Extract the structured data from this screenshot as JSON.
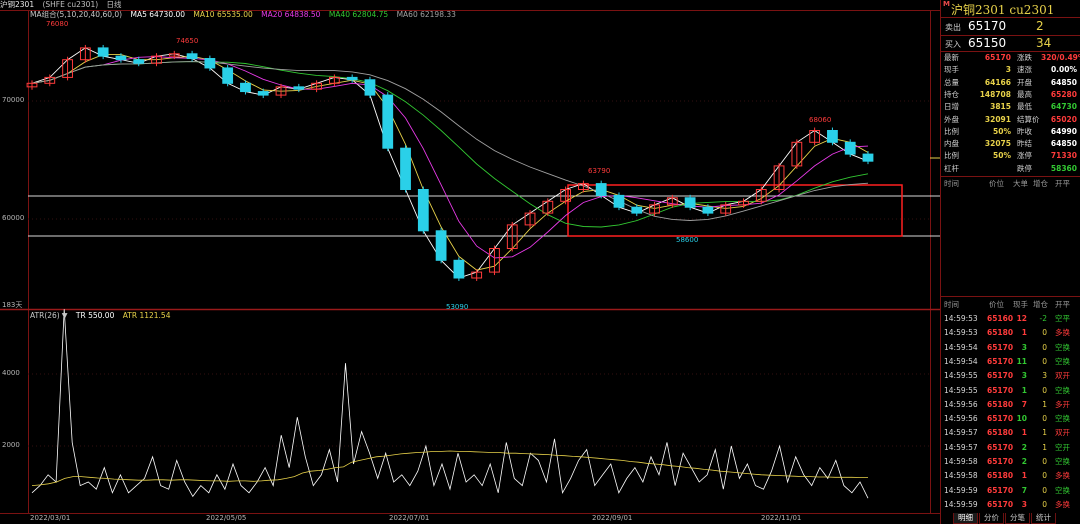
{
  "header": {
    "title": "沪铜2301",
    "code": "(SHFE cu2301)",
    "period": "日线"
  },
  "ma": {
    "label": "MA组合(5,10,20,40,60,0)",
    "ma5": "MA5 64730.00",
    "ma10": "MA10 65535.00",
    "ma20": "MA20 64838.50",
    "ma40": "MA40 62804.75",
    "ma60": "MA60 62198.33"
  },
  "colors": {
    "up": "#ff3b3b",
    "down": "#2ad0e8",
    "ma5": "#ffffff",
    "ma10": "#e8d24a",
    "ma20": "#e83ae8",
    "ma40": "#32c832",
    "ma60": "#a0a0a0",
    "accent": "#e8d24a"
  },
  "price_axis": {
    "ticks": [
      "70000",
      "60000"
    ],
    "days": "183天"
  },
  "price_labels": {
    "p76080": "76080",
    "p74650": "74650",
    "p53090": "53090",
    "p63790": "63790",
    "p58600": "58600",
    "p68060": "68060"
  },
  "atr": {
    "label": "ATR(26)",
    "arrow": "▼",
    "tr": "TR 550.00",
    "atr": "ATR 1121.54",
    "ticks": [
      "4000",
      "2000"
    ]
  },
  "xaxis": [
    "2022/03/01",
    "2022/05/05",
    "2022/07/01",
    "2022/09/01",
    "2022/11/01"
  ],
  "panel": {
    "marker": "M",
    "name": "沪铜2301  cu2301",
    "sell_label": "卖出",
    "sell_price": "65170",
    "sell_qty": "2",
    "buy_label": "买入",
    "buy_price": "65150",
    "buy_qty": "34",
    "quotes": [
      {
        "k1": "最新",
        "v1": "65170",
        "c1": "#ff3b3b",
        "k2": "涨跌",
        "v2": "320/0.49%",
        "c2": "#ff3b3b"
      },
      {
        "k1": "现手",
        "v1": "3",
        "c1": "#e8d24a",
        "k2": "速涨",
        "v2": "0.00%",
        "c2": "#ffffff"
      },
      {
        "k1": "总量",
        "v1": "64166",
        "c1": "#e8d24a",
        "k2": "开盘",
        "v2": "64850",
        "c2": "#ffffff"
      },
      {
        "k1": "持仓",
        "v1": "148708",
        "c1": "#e8d24a",
        "k2": "最高",
        "v2": "65280",
        "c2": "#ff3b3b"
      },
      {
        "k1": "日增",
        "v1": "3815",
        "c1": "#e8d24a",
        "k2": "最低",
        "v2": "64730",
        "c2": "#32c832"
      },
      {
        "k1": "外盘",
        "v1": "32091",
        "c1": "#e8d24a",
        "k2": "结算价",
        "v2": "65020",
        "c2": "#ff3b3b"
      },
      {
        "k1": "比例",
        "v1": "50%",
        "c1": "#e8d24a",
        "k2": "昨收",
        "v2": "64990",
        "c2": "#ffffff"
      },
      {
        "k1": "内盘",
        "v1": "32075",
        "c1": "#e8d24a",
        "k2": "昨结",
        "v2": "64850",
        "c2": "#ffffff"
      },
      {
        "k1": "比例",
        "v1": "50%",
        "c1": "#e8d24a",
        "k2": "涨停",
        "v2": "71330",
        "c2": "#ff3b3b"
      },
      {
        "k1": "杠杆",
        "v1": "",
        "c1": "#e8d24a",
        "k2": "跌停",
        "v2": "58360",
        "c2": "#32c832"
      }
    ],
    "hdr1": {
      "time": "时间",
      "price": "价位",
      "big": "大单",
      "add": "增仓",
      "oc": "开平"
    },
    "hdr2": {
      "time": "时间",
      "price": "价位",
      "qty": "现手",
      "add": "增仓",
      "oc": "开平"
    },
    "ticks": [
      {
        "time": "14:59:53",
        "price": "65160",
        "qty": "12",
        "add": "-2",
        "oc": "空平",
        "pc": "#ff3b3b",
        "qc": "#ff3b3b",
        "ac": "#32c832",
        "oc_c": "#32c832"
      },
      {
        "time": "14:59:53",
        "price": "65180",
        "qty": "1",
        "add": "0",
        "oc": "多换",
        "pc": "#ff3b3b",
        "qc": "#ff3b3b",
        "ac": "#e8d24a",
        "oc_c": "#ff3b3b"
      },
      {
        "time": "14:59:54",
        "price": "65170",
        "qty": "3",
        "add": "0",
        "oc": "空换",
        "pc": "#ff3b3b",
        "qc": "#32c832",
        "ac": "#e8d24a",
        "oc_c": "#32c832"
      },
      {
        "time": "14:59:54",
        "price": "65170",
        "qty": "11",
        "add": "0",
        "oc": "空换",
        "pc": "#ff3b3b",
        "qc": "#32c832",
        "ac": "#e8d24a",
        "oc_c": "#32c832"
      },
      {
        "time": "14:59:55",
        "price": "65170",
        "qty": "3",
        "add": "3",
        "oc": "双开",
        "pc": "#ff3b3b",
        "qc": "#32c832",
        "ac": "#e8d24a",
        "oc_c": "#ff3b3b"
      },
      {
        "time": "14:59:55",
        "price": "65170",
        "qty": "1",
        "add": "0",
        "oc": "空换",
        "pc": "#ff3b3b",
        "qc": "#32c832",
        "ac": "#e8d24a",
        "oc_c": "#32c832"
      },
      {
        "time": "14:59:56",
        "price": "65180",
        "qty": "7",
        "add": "1",
        "oc": "多开",
        "pc": "#ff3b3b",
        "qc": "#ff3b3b",
        "ac": "#e8d24a",
        "oc_c": "#ff3b3b"
      },
      {
        "time": "14:59:56",
        "price": "65170",
        "qty": "10",
        "add": "0",
        "oc": "空换",
        "pc": "#ff3b3b",
        "qc": "#32c832",
        "ac": "#e8d24a",
        "oc_c": "#32c832"
      },
      {
        "time": "14:59:57",
        "price": "65180",
        "qty": "1",
        "add": "1",
        "oc": "双开",
        "pc": "#ff3b3b",
        "qc": "#ff3b3b",
        "ac": "#e8d24a",
        "oc_c": "#ff3b3b"
      },
      {
        "time": "14:59:57",
        "price": "65170",
        "qty": "2",
        "add": "1",
        "oc": "空开",
        "pc": "#ff3b3b",
        "qc": "#32c832",
        "ac": "#e8d24a",
        "oc_c": "#32c832"
      },
      {
        "time": "14:59:58",
        "price": "65170",
        "qty": "2",
        "add": "0",
        "oc": "空换",
        "pc": "#ff3b3b",
        "qc": "#32c832",
        "ac": "#e8d24a",
        "oc_c": "#32c832"
      },
      {
        "time": "14:59:58",
        "price": "65180",
        "qty": "1",
        "add": "0",
        "oc": "多换",
        "pc": "#ff3b3b",
        "qc": "#ff3b3b",
        "ac": "#e8d24a",
        "oc_c": "#ff3b3b"
      },
      {
        "time": "14:59:59",
        "price": "65170",
        "qty": "7",
        "add": "0",
        "oc": "空换",
        "pc": "#ff3b3b",
        "qc": "#32c832",
        "ac": "#e8d24a",
        "oc_c": "#32c832"
      },
      {
        "time": "14:59:59",
        "price": "65170",
        "qty": "3",
        "add": "0",
        "oc": "多换",
        "pc": "#ff3b3b",
        "qc": "#ff3b3b",
        "ac": "#e8d24a",
        "oc_c": "#ff3b3b"
      }
    ],
    "tabs": [
      "明细",
      "分价",
      "分笔",
      "统计"
    ]
  },
  "chart_data": [
    {
      "type": "candlestick",
      "title": "沪铜2301 (SHFE cu2301) 日线",
      "series_names": [
        "MA5",
        "MA10",
        "MA20",
        "MA40",
        "MA60"
      ],
      "y_ticks": [
        70000,
        60000
      ],
      "annotations": [
        {
          "label": "76080",
          "type": "high"
        },
        {
          "label": "74650",
          "type": "high"
        },
        {
          "label": "53090",
          "type": "low"
        },
        {
          "label": "63790",
          "type": "high"
        },
        {
          "label": "58600",
          "type": "low"
        },
        {
          "label": "68060",
          "type": "high"
        }
      ],
      "close_approx": [
        71500,
        72000,
        73500,
        74500,
        73800,
        73500,
        73200,
        73800,
        74000,
        73600,
        72800,
        71500,
        70800,
        70500,
        71200,
        71000,
        71500,
        72000,
        71800,
        70500,
        66000,
        62500,
        59000,
        56500,
        55000,
        55500,
        57500,
        59500,
        60500,
        61500,
        62500,
        63000,
        62000,
        61000,
        60500,
        61200,
        61800,
        61000,
        60500,
        61200,
        61500,
        62500,
        64500,
        66500,
        67500,
        66500,
        65500,
        64900
      ]
    },
    {
      "type": "line",
      "title": "ATR(26)",
      "series_names": [
        "TR",
        "ATR"
      ],
      "y_ticks": [
        4000,
        2000
      ],
      "tr": [
        700,
        900,
        1200,
        1000,
        5800,
        2100,
        900,
        1000,
        800,
        1400,
        700,
        1200,
        700,
        900,
        1100,
        1700,
        900,
        800,
        1600,
        1000,
        600,
        900,
        700,
        1200,
        800,
        1500,
        900,
        700,
        1000,
        1400,
        900,
        2300,
        1400,
        2800,
        1700,
        900,
        1200,
        1900,
        1000,
        4300,
        1500,
        2400,
        1800,
        1100,
        1800,
        1000,
        1200,
        900,
        1300,
        2000,
        900,
        1500,
        800,
        1800,
        1000,
        1200,
        900,
        1500,
        700,
        2100,
        1100,
        900,
        1800,
        1600,
        1000,
        2200,
        700,
        1100,
        1600,
        1900,
        900,
        1200,
        1500,
        700,
        1100,
        1400,
        1000,
        1700,
        1200,
        2100,
        900,
        1800,
        1400,
        1000,
        1200,
        1900,
        800,
        2000,
        1100,
        1500,
        900,
        800,
        1300,
        2000,
        1000,
        1700,
        1200,
        900,
        1400,
        1100,
        1600,
        900,
        700,
        1000,
        550
      ],
      "atr": [
        900,
        920,
        950,
        1000,
        1100,
        1150,
        1150,
        1130,
        1110,
        1100,
        1080,
        1070,
        1060,
        1050,
        1050,
        1060,
        1060,
        1050,
        1060,
        1060,
        1050,
        1040,
        1030,
        1030,
        1020,
        1030,
        1030,
        1020,
        1030,
        1050,
        1060,
        1100,
        1150,
        1250,
        1300,
        1320,
        1350,
        1400,
        1420,
        1550,
        1600,
        1650,
        1700,
        1720,
        1750,
        1780,
        1800,
        1820,
        1830,
        1850,
        1850,
        1860,
        1850,
        1850,
        1840,
        1830,
        1820,
        1820,
        1800,
        1800,
        1790,
        1780,
        1770,
        1760,
        1740,
        1730,
        1710,
        1700,
        1680,
        1660,
        1640,
        1620,
        1600,
        1570,
        1550,
        1520,
        1500,
        1480,
        1450,
        1430,
        1400,
        1380,
        1350,
        1330,
        1300,
        1280,
        1260,
        1240,
        1220,
        1200,
        1190,
        1180,
        1170,
        1160,
        1150,
        1150,
        1140,
        1140,
        1130,
        1130,
        1130,
        1125,
        1122
      ]
    }
  ]
}
